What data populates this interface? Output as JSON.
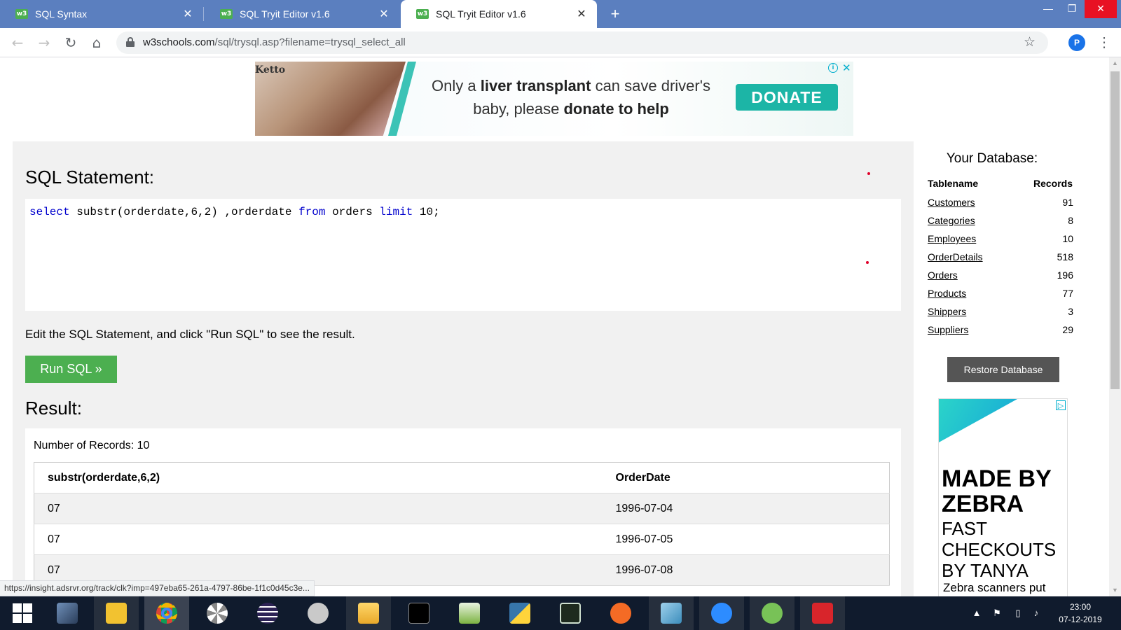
{
  "browser": {
    "tabs": [
      {
        "title": "SQL Syntax",
        "icon": "w3schools-favicon",
        "active": false
      },
      {
        "title": "SQL Tryit Editor v1.6",
        "icon": "w3schools-favicon",
        "active": false
      },
      {
        "title": "SQL Tryit Editor v1.6",
        "icon": "w3schools-favicon",
        "active": true
      }
    ],
    "url_host": "w3schools.com",
    "url_path": "/sql/trysql.asp?filename=trysql_select_all",
    "profile_initial": "P",
    "favicon_text": "w3"
  },
  "ad": {
    "brand": "Ketto",
    "line1_pre": "Only a ",
    "line1_bold": "liver transplant",
    "line1_post": " can save driver's",
    "line2_pre": "baby, please ",
    "line2_bold": "donate to help",
    "cta": "DONATE",
    "info_glyph": "i",
    "close_glyph": "✕"
  },
  "editor": {
    "heading": "SQL Statement:",
    "code": {
      "kw1": "select",
      "p1": " substr(orderdate,6,2) ,orderdate ",
      "kw2": "from",
      "p2": " orders ",
      "kw3": "limit",
      "p3": " 10;"
    },
    "hint": "Edit the SQL Statement, and click \"Run SQL\" to see the result.",
    "run_label": "Run SQL »"
  },
  "result": {
    "heading": "Result:",
    "count_text": "Number of Records: 10",
    "columns": [
      "substr(orderdate,6,2)",
      "OrderDate"
    ],
    "rows": [
      [
        "07",
        "1996-07-04"
      ],
      [
        "07",
        "1996-07-05"
      ],
      [
        "07",
        "1996-07-08"
      ]
    ]
  },
  "database": {
    "title": "Your Database:",
    "head_table": "Tablename",
    "head_records": "Records",
    "tables": [
      {
        "name": "Customers",
        "records": "91"
      },
      {
        "name": "Categories",
        "records": "8"
      },
      {
        "name": "Employees",
        "records": "10"
      },
      {
        "name": "OrderDetails",
        "records": "518"
      },
      {
        "name": "Orders",
        "records": "196"
      },
      {
        "name": "Products",
        "records": "77"
      },
      {
        "name": "Shippers",
        "records": "3"
      },
      {
        "name": "Suppliers",
        "records": "29"
      }
    ],
    "restore_label": "Restore Database"
  },
  "side_ad": {
    "headline": "MADE BY ZEBRA",
    "subhead": "FAST CHECKOUTS BY TANYA",
    "body": "Zebra scanners put",
    "choice_glyph": "▷"
  },
  "status_url": "https://insight.adsrvr.org/track/clk?imp=497eba65-261a-4797-86be-1f1c0d45c3e...",
  "taskbar": {
    "time": "23:00",
    "date": "07-12-2019",
    "apps": [
      "windows-start",
      "file-manager",
      "sticky-app",
      "chrome",
      "pinwheel-app",
      "eclipse",
      "satellite-app",
      "file-explorer",
      "terminal",
      "chart-app",
      "python",
      "sql-app",
      "brush-app",
      "slides-app",
      "zoom",
      "utorrent",
      "acrobat"
    ]
  },
  "colors": {
    "tabbar": "#5b7fbf",
    "run_button": "#4caf50",
    "sql_keyword": "#0000cd",
    "restore_button": "#555555",
    "donate_button": "#1cb5a6"
  }
}
